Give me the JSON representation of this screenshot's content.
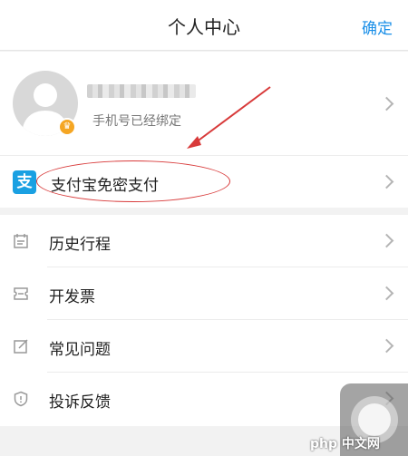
{
  "header": {
    "title": "个人中心",
    "confirm_label": "确定"
  },
  "profile": {
    "phone_status": "手机号已经绑定"
  },
  "alipay": {
    "label": "支付宝免密支付",
    "logo_glyph": "支"
  },
  "menu": {
    "items": [
      {
        "label": "历史行程",
        "icon": "calendar-icon"
      },
      {
        "label": "开发票",
        "icon": "ticket-icon"
      },
      {
        "label": "常见问题",
        "icon": "edit-icon"
      },
      {
        "label": "投诉反馈",
        "icon": "shield-icon"
      }
    ]
  },
  "colors": {
    "accent": "#1a8fe8",
    "alipay_blue": "#1aa0e2",
    "annotation_red": "#d83a3a"
  },
  "watermark": "php 中文网"
}
